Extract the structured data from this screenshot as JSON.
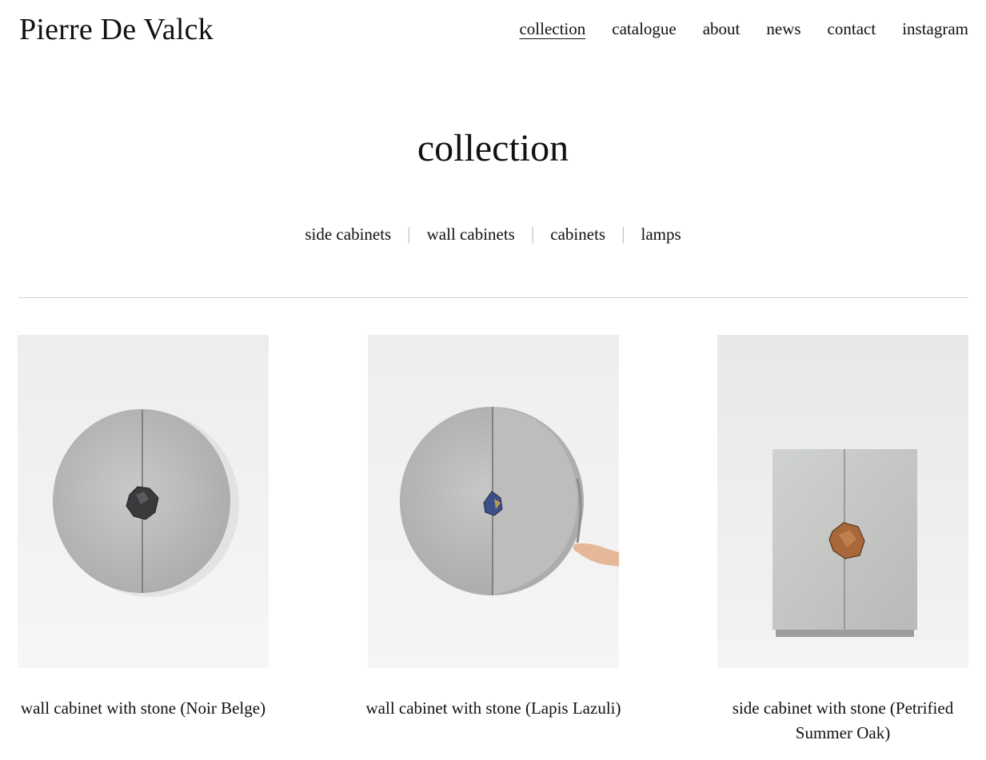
{
  "site": {
    "brand": "Pierre De Valck"
  },
  "nav": {
    "items": [
      {
        "label": "collection",
        "active": true
      },
      {
        "label": "catalogue"
      },
      {
        "label": "about"
      },
      {
        "label": "news"
      },
      {
        "label": "contact"
      },
      {
        "label": "instagram"
      }
    ]
  },
  "page": {
    "title": "collection"
  },
  "filters": {
    "items": [
      "side cabinets",
      "wall cabinets",
      "cabinets",
      "lamps"
    ],
    "separator": "|"
  },
  "products": [
    {
      "caption": "wall cabinet with stone (Noir Belge)",
      "stone_color": "#3a3a3c"
    },
    {
      "caption": "wall cabinet with stone (Lapis Lazuli)",
      "stone_color": "#3b4f8a"
    },
    {
      "caption": "side cabinet with stone (Petrified Summer Oak)",
      "stone_color": "#a8683a"
    }
  ]
}
